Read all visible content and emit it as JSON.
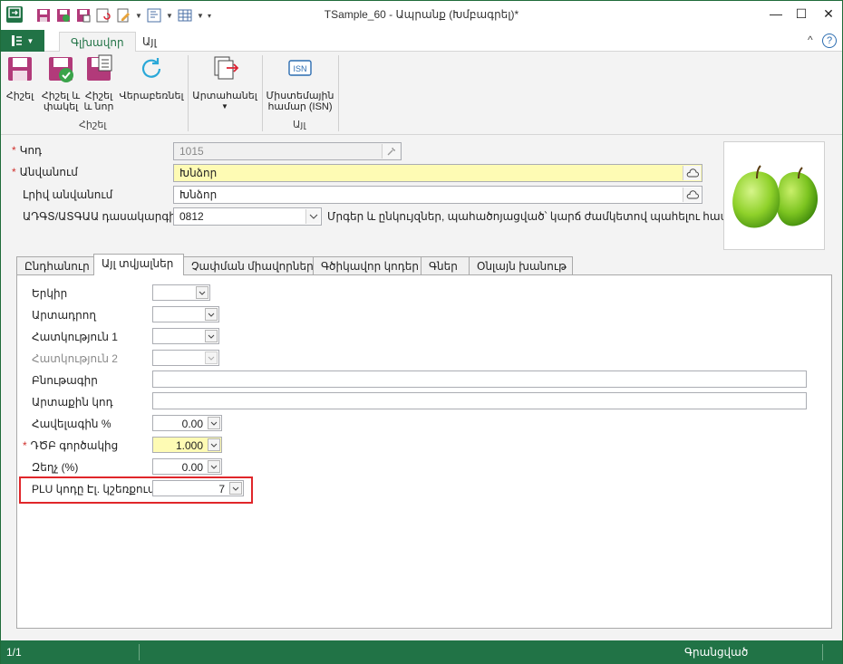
{
  "window": {
    "title": "TSample_60 - Ապրանք (Խմբագրել)*"
  },
  "ribbon": {
    "tabs": [
      "Գլխավոր",
      "Այլ"
    ],
    "buttons": {
      "save": "Հիշել",
      "save_close_line1": "Հիշել և",
      "save_close_line2": "փակել",
      "save_new_line1": "Հիշել",
      "save_new_line2": "և նոր",
      "reload": "Վերաբեռնել",
      "export": "Արտահանել",
      "isn_line1": "Միստեմային",
      "isn_line2": "համար (ISN)"
    },
    "groups": {
      "save": "Հիշել",
      "other": "Այլ"
    }
  },
  "form": {
    "code_label": "Կոդ",
    "code_value": "1015",
    "name_label": "Անվանում",
    "name_value": "Խնձոր",
    "fullname_label": "Լրիվ անվանում",
    "fullname_value": "Խնձոր",
    "category_label": "ԱԴԳՏ/ԱՏԳԱԱ դասակարգիչ",
    "category_value": "0812",
    "category_desc": "Մրգեր և ընկույզներ, պահածոյացված՝ կարճ ժամկետով պահելու համար (o"
  },
  "tabs": [
    "Ընդհանուր",
    "Այլ տվյալներ",
    "Չափման միավորներ",
    "Գծիկավոր կոդեր",
    "Գներ",
    "Օնլայն խանութ"
  ],
  "panel": {
    "country_label": "Երկիր",
    "manufacturer_label": "Արտադրող",
    "attr1_label": "Հատկություն 1",
    "attr2_label": "Հատկություն 2",
    "nature_label": "Բնութագիր",
    "external_code_label": "Արտաքին կոդ",
    "markup_label": "Հավելագին %",
    "markup_value": "0.00",
    "vat_label": "ԴԾԲ գործակից",
    "vat_value": "1.000",
    "discount_label": "Զեղչ (%)",
    "discount_value": "0.00",
    "plu_label": "PLU կոդը Էլ. կշեռքում",
    "plu_value": "7"
  },
  "status": {
    "record": "1/1",
    "state": "Գրանցված"
  },
  "colors": {
    "accent": "#217346",
    "required": "#d0312d",
    "highlight_box": "#e0262a",
    "yellow_field": "#fefbb4"
  }
}
